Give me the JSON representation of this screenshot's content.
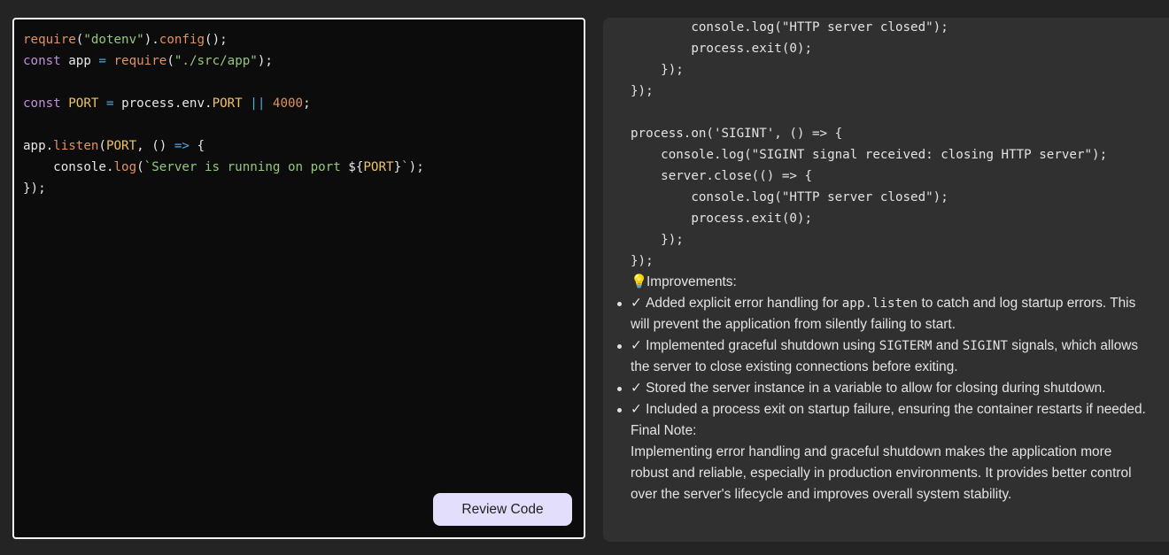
{
  "editor": {
    "lines": [
      [
        {
          "t": "require",
          "c": "fn"
        },
        {
          "t": "(",
          "c": "pl"
        },
        {
          "t": "\"dotenv\"",
          "c": "str"
        },
        {
          "t": ").",
          "c": "pl"
        },
        {
          "t": "config",
          "c": "fn"
        },
        {
          "t": "();",
          "c": "pl"
        }
      ],
      [
        {
          "t": "const ",
          "c": "kw"
        },
        {
          "t": "app ",
          "c": "pl"
        },
        {
          "t": "= ",
          "c": "op"
        },
        {
          "t": "require",
          "c": "fn"
        },
        {
          "t": "(",
          "c": "pl"
        },
        {
          "t": "\"./src/app\"",
          "c": "str"
        },
        {
          "t": ");",
          "c": "pl"
        }
      ],
      [],
      [
        {
          "t": "const ",
          "c": "kw"
        },
        {
          "t": "PORT ",
          "c": "var"
        },
        {
          "t": "= ",
          "c": "op"
        },
        {
          "t": "process.env.",
          "c": "pl"
        },
        {
          "t": "PORT ",
          "c": "var"
        },
        {
          "t": "|| ",
          "c": "op"
        },
        {
          "t": "4000",
          "c": "num"
        },
        {
          "t": ";",
          "c": "pl"
        }
      ],
      [],
      [
        {
          "t": "app.",
          "c": "pl"
        },
        {
          "t": "listen",
          "c": "fn"
        },
        {
          "t": "(",
          "c": "pl"
        },
        {
          "t": "PORT",
          "c": "var"
        },
        {
          "t": ", () ",
          "c": "pl"
        },
        {
          "t": "=> ",
          "c": "op"
        },
        {
          "t": "{",
          "c": "pl"
        }
      ],
      [
        {
          "t": "    console.",
          "c": "pl"
        },
        {
          "t": "log",
          "c": "fn"
        },
        {
          "t": "(",
          "c": "pl"
        },
        {
          "t": "`Server is running on port ",
          "c": "str"
        },
        {
          "t": "${",
          "c": "pl"
        },
        {
          "t": "PORT",
          "c": "var"
        },
        {
          "t": "}",
          "c": "pl"
        },
        {
          "t": "`",
          "c": "str"
        },
        {
          "t": ");",
          "c": "pl"
        }
      ],
      [
        {
          "t": "});",
          "c": "pl"
        }
      ]
    ],
    "review_button_label": "Review Code"
  },
  "review": {
    "code_lines": [
      "        console.log(\"HTTP server closed\");",
      "        process.exit(0);",
      "    });",
      "});",
      "",
      "process.on('SIGINT', () => {",
      "    console.log(\"SIGINT signal received: closing HTTP server\");",
      "    server.close(() => {",
      "        console.log(\"HTTP server closed\");",
      "        process.exit(0);",
      "    });",
      "});"
    ],
    "improvements_icon": "💡",
    "improvements_heading": "Improvements:",
    "items": [
      [
        {
          "t": "✓ ",
          "c": "check"
        },
        {
          "t": "Added explicit error handling for ",
          "c": "txt"
        },
        {
          "t": "app.listen",
          "c": "mono"
        },
        {
          "t": " to catch and log startup errors. This will prevent the application from silently failing to start.",
          "c": "txt"
        }
      ],
      [
        {
          "t": "✓ ",
          "c": "check"
        },
        {
          "t": "Implemented graceful shutdown using ",
          "c": "txt"
        },
        {
          "t": "SIGTERM",
          "c": "mono"
        },
        {
          "t": " and ",
          "c": "txt"
        },
        {
          "t": "SIGINT",
          "c": "mono"
        },
        {
          "t": " signals, which allows the server to close existing connections before exiting.",
          "c": "txt"
        }
      ],
      [
        {
          "t": "✓ ",
          "c": "check"
        },
        {
          "t": "Stored the server instance in a variable to allow for closing during shutdown.",
          "c": "txt"
        }
      ],
      [
        {
          "t": "✓ ",
          "c": "check"
        },
        {
          "t": "Included a process exit on startup failure, ensuring the container restarts if needed.",
          "c": "txt"
        }
      ]
    ],
    "final_note_heading": "Final Note:",
    "final_note_text": "Implementing error handling and graceful shutdown makes the application more robust and reliable, especially in production environments. It provides better control over the server's lifecycle and improves overall system stability."
  },
  "colors": {
    "page_bg": "#242424",
    "editor_bg": "#0c0c0c",
    "editor_border": "#f2f2f2",
    "review_bg": "#303030",
    "button_bg": "#e2defc",
    "token_fn": "#e2925e",
    "token_str": "#95c77a",
    "token_kw": "#c191d8",
    "token_var": "#f2c35e",
    "token_op": "#56a8d6"
  }
}
